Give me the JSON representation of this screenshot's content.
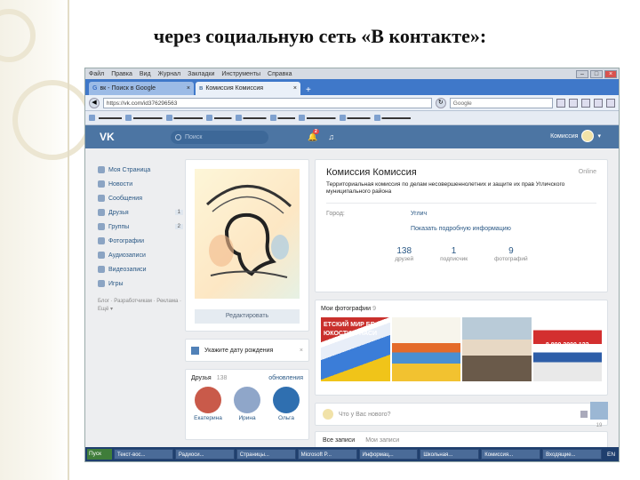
{
  "slide": {
    "title": "через социальную сеть «В контакте»:"
  },
  "browser": {
    "menu": [
      "Файл",
      "Правка",
      "Вид",
      "Журнал",
      "Закладки",
      "Инструменты",
      "Справка"
    ],
    "tabs": [
      {
        "label": "вк - Поиск в Google",
        "active": false
      },
      {
        "label": "Комиссия Комиссия",
        "active": true
      }
    ],
    "url": "https://vk.com/id376296563",
    "search_placeholder": "Google",
    "bookmarks": [
      "",
      "",
      "",
      "",
      "",
      "",
      "",
      "",
      "",
      ""
    ]
  },
  "vk": {
    "logo": "VK",
    "search_placeholder": "Поиск",
    "notif_count": "2",
    "user_name": "Комиссия",
    "sidebar": [
      {
        "label": "Моя Страница",
        "count": ""
      },
      {
        "label": "Новости",
        "count": ""
      },
      {
        "label": "Сообщения",
        "count": ""
      },
      {
        "label": "Друзья",
        "count": "1"
      },
      {
        "label": "Группы",
        "count": "2"
      },
      {
        "label": "Фотографии",
        "count": ""
      },
      {
        "label": "Аудиозаписи",
        "count": ""
      },
      {
        "label": "Видеозаписи",
        "count": ""
      },
      {
        "label": "Игры",
        "count": ""
      }
    ],
    "sidebar_footer": "Блог · Разработчикам · Реклама · Ещё ▾",
    "edit_button": "Редактировать",
    "birthday_prompt": "Укажите дату рождения",
    "friends": {
      "title": "Друзья",
      "count": "138",
      "updates": "обновления",
      "people": [
        {
          "name": "Екатерина",
          "color": "#c95a4a"
        },
        {
          "name": "Ирина",
          "color": "#8fa6c9"
        },
        {
          "name": "Ольга",
          "color": "#2f6fb0"
        }
      ]
    },
    "profile": {
      "name": "Комиссия Комиссия",
      "online": "Online",
      "status": "Территориальная комиссия по делам несовершеннолетних и защите их прав Угличского муниципального района",
      "city_label": "Город:",
      "city_value": "Углич",
      "more_link": "Показать подробную информацию",
      "counters": [
        {
          "n": "138",
          "l": "друзей"
        },
        {
          "n": "1",
          "l": "подписчик"
        },
        {
          "n": "9",
          "l": "фотографий"
        }
      ]
    },
    "photos": {
      "title": "Мои фотографии",
      "count": "9",
      "p1_text": "ЕТСКИЙ МИР БЕ ЮКОСТИ И НАСИ",
      "p4_text": "8 800 2000 122"
    },
    "post_placeholder": "Что у Вас нового?",
    "wall_tabs": [
      "Все записи",
      "Мои записи"
    ],
    "right_count": "19"
  },
  "taskbar": {
    "start": "Пуск",
    "items": [
      "Текст-вос...",
      "Радиоси...",
      "Страницы...",
      "Microsoft P...",
      "Информац...",
      "Школьная...",
      "Комиссия...",
      "Входящие..."
    ],
    "tray": "EN"
  }
}
